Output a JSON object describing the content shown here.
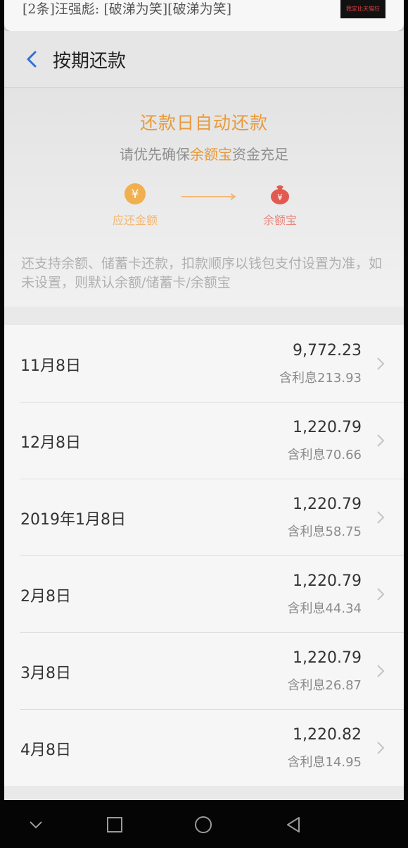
{
  "notification": {
    "text": "[2条]汪强彪: [破涕为笑][破涕为笑]",
    "thumb_text": "我定比天猫狂"
  },
  "header": {
    "title": "按期还款",
    "back_icon": "chevron-left-icon"
  },
  "promo": {
    "title": "还款日自动还款",
    "subtitle_prefix": "请优先确保",
    "subtitle_highlight": "余额宝",
    "subtitle_suffix": "资金充足",
    "from_label": "应还金额",
    "to_label": "余额宝",
    "from_icon": "yen-coin-icon",
    "to_icon": "money-bag-icon",
    "note": "还支持余额、储蓄卡还款，扣款顺序以钱包支付设置为准，如未设置，则默认余额/储蓄卡/余额宝"
  },
  "installments": [
    {
      "date": "11月8日",
      "amount": "9,772.23",
      "interest_label": "含利息",
      "interest": "213.93"
    },
    {
      "date": "12月8日",
      "amount": "1,220.79",
      "interest_label": "含利息",
      "interest": "70.66"
    },
    {
      "date": "2019年1月8日",
      "amount": "1,220.79",
      "interest_label": "含利息",
      "interest": "58.75"
    },
    {
      "date": "2月8日",
      "amount": "1,220.79",
      "interest_label": "含利息",
      "interest": "44.34"
    },
    {
      "date": "3月8日",
      "amount": "1,220.79",
      "interest_label": "含利息",
      "interest": "26.87"
    },
    {
      "date": "4月8日",
      "amount": "1,220.82",
      "interest_label": "含利息",
      "interest": "14.95"
    }
  ],
  "colors": {
    "accent_orange": "#e89a3c",
    "accent_red": "#e05a4f",
    "back_blue": "#2f6fd6"
  },
  "navbar": {
    "icons": [
      "chevron-down-icon",
      "square-icon",
      "circle-icon",
      "triangle-back-icon"
    ]
  }
}
